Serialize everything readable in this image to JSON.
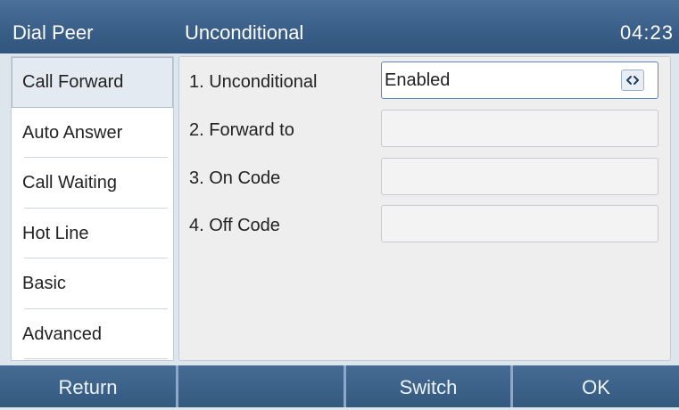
{
  "header": {
    "title": "Dial Peer",
    "subtitle": "Unconditional",
    "time": "04:23"
  },
  "sidebar": {
    "selected_index": 0,
    "items": [
      {
        "label": "Call Forward"
      },
      {
        "label": "Auto Answer"
      },
      {
        "label": "Call Waiting"
      },
      {
        "label": "Hot Line"
      },
      {
        "label": "Basic"
      },
      {
        "label": "Advanced"
      }
    ]
  },
  "form": {
    "active_index": 0,
    "rows": [
      {
        "label": "1. Unconditional",
        "value": "Enabled",
        "icon": "left-right-arrows-icon"
      },
      {
        "label": "2. Forward to",
        "value": ""
      },
      {
        "label": "3. On Code",
        "value": ""
      },
      {
        "label": "4. Off Code",
        "value": ""
      }
    ]
  },
  "softkeys": [
    {
      "label": "Return"
    },
    {
      "label": ""
    },
    {
      "label": "Switch"
    },
    {
      "label": "OK"
    }
  ],
  "colors": {
    "header": "#3a5f88",
    "accent": "#5b88bd",
    "selected_item": "#e3eaf2",
    "panel": "#eeeeee"
  }
}
